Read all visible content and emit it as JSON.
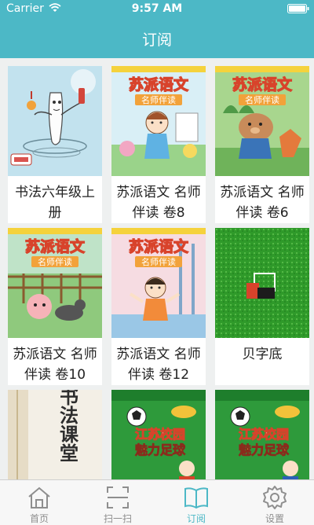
{
  "status_bar": {
    "carrier": "Carrier",
    "time": "9:57 AM"
  },
  "nav": {
    "title": "订阅"
  },
  "books": [
    {
      "title": "书法六年级上册"
    },
    {
      "title": "苏派语文 名师伴读 卷8",
      "cover_text": "苏派语文",
      "cover_sub": "名师伴读"
    },
    {
      "title": "苏派语文 名师伴读 卷6",
      "cover_text": "苏派语文",
      "cover_sub": "名师伴读"
    },
    {
      "title": "苏派语文 名师伴读 卷10",
      "cover_text": "苏派语文",
      "cover_sub": "名师伴读"
    },
    {
      "title": "苏派语文 名师伴读 卷12",
      "cover_text": "苏派语文",
      "cover_sub": "名师伴读"
    },
    {
      "title": "贝字底"
    },
    {
      "cover_text": "书法课堂"
    },
    {
      "cover_text": "江苏校园",
      "cover_sub": "魅力足球"
    },
    {
      "cover_text": "江苏校园",
      "cover_sub": "魅力足球"
    }
  ],
  "tabs": [
    {
      "label": "首页",
      "icon": "home-icon"
    },
    {
      "label": "扫一扫",
      "icon": "scan-icon"
    },
    {
      "label": "订阅",
      "icon": "book-icon",
      "active": true
    },
    {
      "label": "设置",
      "icon": "gear-icon"
    }
  ],
  "colors": {
    "accent": "#4cb8c6",
    "inactive": "#8e8e8e"
  }
}
